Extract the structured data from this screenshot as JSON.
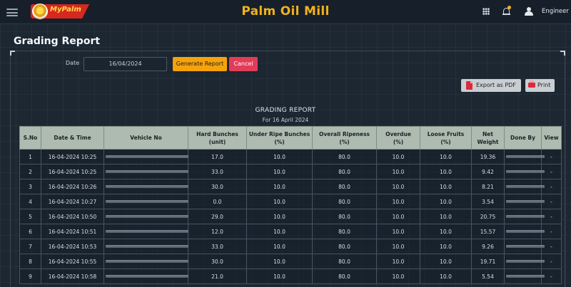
{
  "header": {
    "logo_text": "MyPalm",
    "app_title": "Palm Oil Mill",
    "user_name": "Engineer"
  },
  "page": {
    "title": "Grading Report"
  },
  "filter": {
    "date_label": "Date",
    "date_value": "16/04/2024",
    "generate_label": "Generate Report",
    "cancel_label": "Cancel"
  },
  "actions": {
    "export_pdf_label": "Export as PDF",
    "print_label": "Print"
  },
  "report": {
    "title": "GRADING REPORT",
    "subtitle": "For 16 April 2024",
    "columns": [
      "S.No",
      "Date & Time",
      "Vehicle No",
      "Hard Bunches\n(unit)",
      "Under Ripe Bunches\n(%)",
      "Overall Ripeness\n(%)",
      "Overdue\n(%)",
      "Loose Fruits\n(%)",
      "Net\nWeight",
      "Done By",
      "View"
    ],
    "rows": [
      {
        "sno": "1",
        "datetime": "16-04-2024 10:25",
        "hard": "17.0",
        "underripe": "10.0",
        "ripeness": "80.0",
        "overdue": "10.0",
        "loose": "10.0",
        "weight": "19.36",
        "view": "-"
      },
      {
        "sno": "2",
        "datetime": "16-04-2024 10:25",
        "hard": "33.0",
        "underripe": "10.0",
        "ripeness": "80.0",
        "overdue": "10.0",
        "loose": "10.0",
        "weight": "9.42",
        "view": "-"
      },
      {
        "sno": "3",
        "datetime": "16-04-2024 10:26",
        "hard": "30.0",
        "underripe": "10.0",
        "ripeness": "80.0",
        "overdue": "10.0",
        "loose": "10.0",
        "weight": "8.21",
        "view": "-"
      },
      {
        "sno": "4",
        "datetime": "16-04-2024 10:27",
        "hard": "0.0",
        "underripe": "10.0",
        "ripeness": "80.0",
        "overdue": "10.0",
        "loose": "10.0",
        "weight": "3.54",
        "view": "-"
      },
      {
        "sno": "5",
        "datetime": "16-04-2024 10:50",
        "hard": "29.0",
        "underripe": "10.0",
        "ripeness": "80.0",
        "overdue": "10.0",
        "loose": "10.0",
        "weight": "20.75",
        "view": "-"
      },
      {
        "sno": "6",
        "datetime": "16-04-2024 10:51",
        "hard": "12.0",
        "underripe": "10.0",
        "ripeness": "80.0",
        "overdue": "10.0",
        "loose": "10.0",
        "weight": "15.57",
        "view": "-"
      },
      {
        "sno": "7",
        "datetime": "16-04-2024 10:53",
        "hard": "33.0",
        "underripe": "10.0",
        "ripeness": "80.0",
        "overdue": "10.0",
        "loose": "10.0",
        "weight": "9.26",
        "view": "-"
      },
      {
        "sno": "8",
        "datetime": "16-04-2024 10:55",
        "hard": "30.0",
        "underripe": "10.0",
        "ripeness": "80.0",
        "overdue": "10.0",
        "loose": "10.0",
        "weight": "19.71",
        "view": "-"
      },
      {
        "sno": "9",
        "datetime": "16-04-2024 10:58",
        "hard": "21.0",
        "underripe": "10.0",
        "ripeness": "80.0",
        "overdue": "10.0",
        "loose": "10.0",
        "weight": "5.54",
        "view": "-"
      }
    ]
  },
  "colors": {
    "accent": "#f2b21d",
    "generate_button": "#f5a20c",
    "cancel_button": "#e23d58",
    "table_header": "#aebbb1",
    "background": "#1c2732"
  },
  "icons": {
    "menu": "hamburger-icon",
    "apps": "grid-icon",
    "notifications": "bell-icon",
    "user": "user-icon",
    "pdf": "pdf-file-icon",
    "print": "printer-icon"
  }
}
